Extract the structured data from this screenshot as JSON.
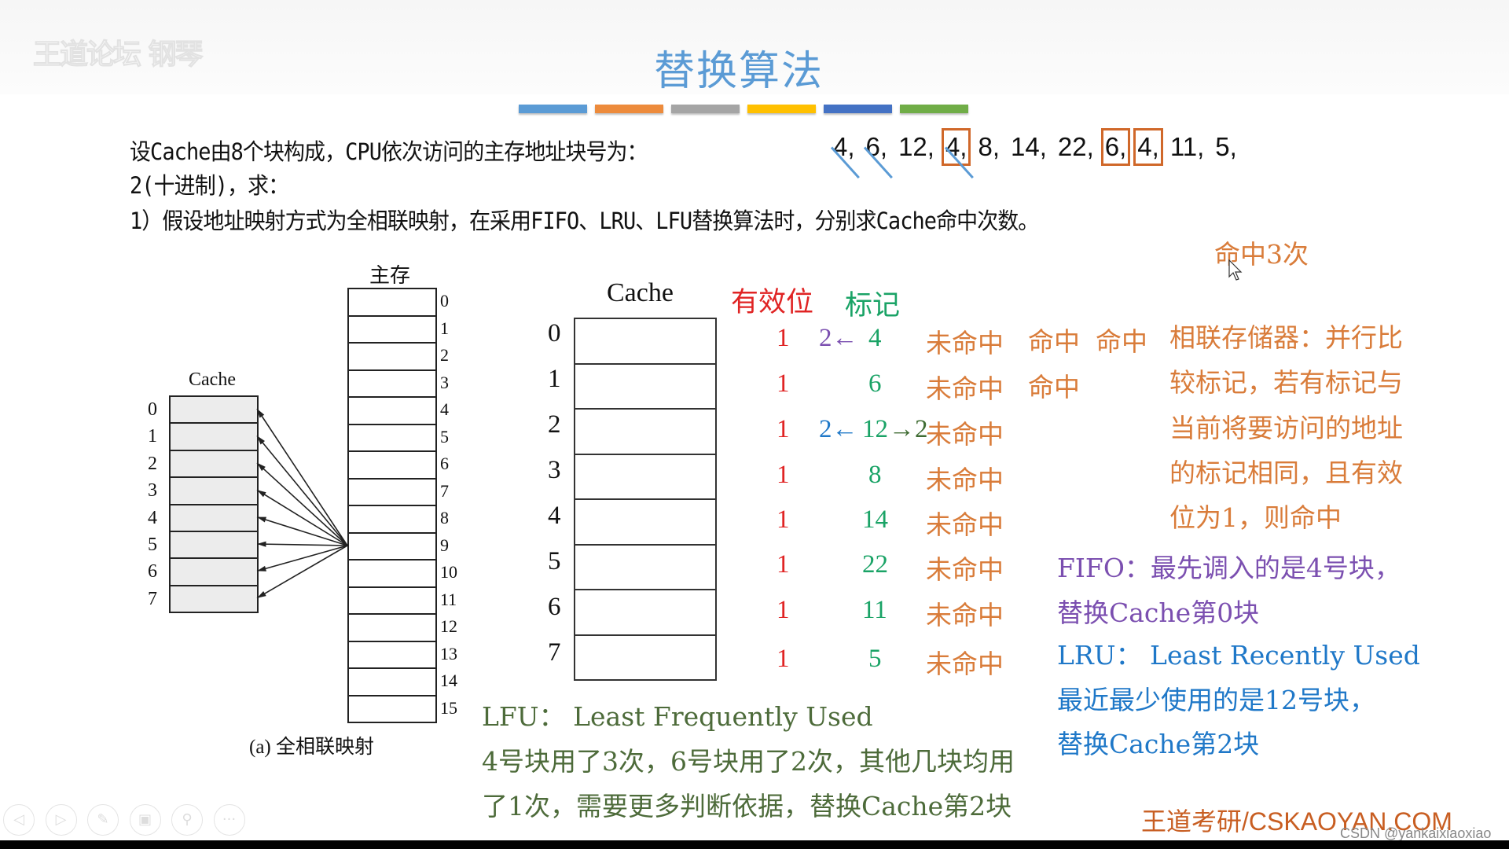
{
  "watermark": "王道论坛 钢琴",
  "title": "替换算法",
  "accent_bars": [
    "#5b9bd5",
    "#ed8b3c",
    "#a5a5a5",
    "#ffc000",
    "#4472c4",
    "#70ad47"
  ],
  "question": {
    "line1_prefix": "设Cache由8个块构成，CPU依次访问的主存地址块号为：",
    "sequence": [
      {
        "value": "4,",
        "struck": true,
        "boxed": false
      },
      {
        "value": "6,",
        "struck": true,
        "boxed": false
      },
      {
        "value": "12,",
        "struck": false,
        "boxed": false
      },
      {
        "value": "4,",
        "struck": true,
        "boxed": true
      },
      {
        "value": "8,",
        "struck": false,
        "boxed": false
      },
      {
        "value": "14,",
        "struck": false,
        "boxed": false
      },
      {
        "value": "22,",
        "struck": false,
        "boxed": false
      },
      {
        "value": "6,",
        "struck": false,
        "boxed": true
      },
      {
        "value": "4,",
        "struck": false,
        "boxed": true
      },
      {
        "value": "11,",
        "struck": false,
        "boxed": false
      },
      {
        "value": "5,",
        "struck": false,
        "boxed": false
      }
    ],
    "line2": "2(十进制)，求：",
    "line3": "1）假设地址映射方式为全相联映射，在采用FIFO、LRU、LFU替换算法时，分别求Cache命中次数。"
  },
  "hit_count": "命中3次",
  "small_diagram": {
    "cache_label": "Cache",
    "cache_rows": [
      "0",
      "1",
      "2",
      "3",
      "4",
      "5",
      "6",
      "7"
    ],
    "memory_label": "主存",
    "memory_rows": [
      "0",
      "1",
      "2",
      "3",
      "4",
      "5",
      "6",
      "7",
      "8",
      "9",
      "10",
      "11",
      "12",
      "13",
      "14",
      "15"
    ],
    "caption": "(a) 全相联映射"
  },
  "cache_table": {
    "label": "Cache",
    "valid_header": "有效位",
    "tag_header": "标记",
    "rows": [
      {
        "index": "0",
        "valid": "1",
        "tag": "4",
        "prefix": "2←",
        "prefix_color": "#7b4fb0",
        "suffix": "",
        "status": "未命中",
        "extra": [
          "命中",
          "命中"
        ]
      },
      {
        "index": "1",
        "valid": "1",
        "tag": "6",
        "prefix": "",
        "prefix_color": "",
        "suffix": "",
        "status": "未命中",
        "extra": [
          "命中"
        ]
      },
      {
        "index": "2",
        "valid": "1",
        "tag": "12",
        "prefix": "2←",
        "prefix_color": "#1f78c8",
        "suffix": "→2",
        "status": "未命中",
        "extra": []
      },
      {
        "index": "3",
        "valid": "1",
        "tag": "8",
        "prefix": "",
        "prefix_color": "",
        "suffix": "",
        "status": "未命中",
        "extra": []
      },
      {
        "index": "4",
        "valid": "1",
        "tag": "14",
        "prefix": "",
        "prefix_color": "",
        "suffix": "",
        "status": "未命中",
        "extra": []
      },
      {
        "index": "5",
        "valid": "1",
        "tag": "22",
        "prefix": "",
        "prefix_color": "",
        "suffix": "",
        "status": "未命中",
        "extra": []
      },
      {
        "index": "6",
        "valid": "1",
        "tag": "11",
        "prefix": "",
        "prefix_color": "",
        "suffix": "",
        "status": "未命中",
        "extra": []
      },
      {
        "index": "7",
        "valid": "1",
        "tag": "5",
        "prefix": "",
        "prefix_color": "",
        "suffix": "",
        "status": "未命中",
        "extra": []
      }
    ]
  },
  "assoc_note": [
    "相联存储器：并行比",
    "较标记，若有标记与",
    "当前将要访问的地址",
    "的标记相同，且有效",
    "位为1，则命中"
  ],
  "fifo_note": [
    "FIFO：最先调入的是4号块，",
    "替换Cache第0块"
  ],
  "lru_note": [
    "LRU：  Least Recently Used",
    "最近最少使用的是12号块，",
    "替换Cache第2块"
  ],
  "lfu_note": [
    "LFU：  Least Frequently Used",
    "4号块用了3次，6号块用了2次，其他几块均用",
    "了1次，需要更多判断依据，替换Cache第2块"
  ],
  "brand": "王道考研/CSKAOYAN.COM",
  "credit": "CSDN @yankaixiaoxiao",
  "controls": [
    {
      "name": "previous",
      "glyph": "◁"
    },
    {
      "name": "next",
      "glyph": "▷"
    },
    {
      "name": "pen",
      "glyph": "✎"
    },
    {
      "name": "slides",
      "glyph": "▣"
    },
    {
      "name": "zoom",
      "glyph": "⚲"
    },
    {
      "name": "more",
      "glyph": "···"
    }
  ]
}
